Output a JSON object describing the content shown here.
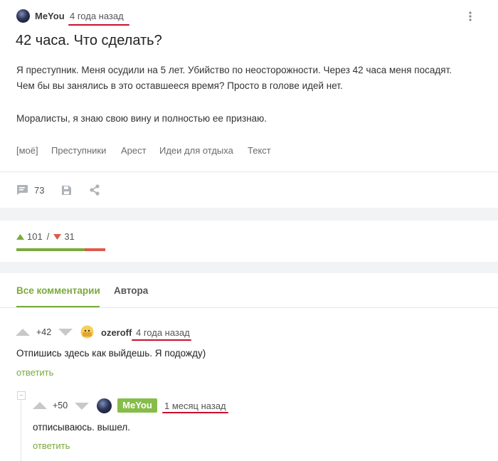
{
  "post": {
    "author": "MeYou",
    "time": "4 года назад",
    "title": "42 часа. Что сделать?",
    "body_lines": [
      "Я преступник. Меня осудили на 5 лет. Убийство по неосторожности. Через 42 часа меня посадят.",
      "Чем бы вы занялись в это оставшееся время? Просто в голове идей нет.",
      "Моралисты, я знаю свою вину и полностью ее признаю."
    ],
    "tags": [
      "[моё]",
      "Преступники",
      "Арест",
      "Идеи для отдыха",
      "Текст"
    ],
    "comments_count": "73",
    "rating_up": "101",
    "rating_separator": "/",
    "rating_down": "31",
    "rating_up_fraction": 0.765
  },
  "colors": {
    "accent_green": "#7aaa3c",
    "down_red": "#dd5a4a",
    "underline_red": "#c8102e",
    "band_gray": "#f2f3f4"
  },
  "comments_tabs": [
    "Все комментарии",
    "Автора"
  ],
  "comments": [
    {
      "score": "+42",
      "author": "ozeroff",
      "time": "4 года назад",
      "text": "Отпишись здесь как выйдешь. Я подожду)",
      "reply_label": "ответить"
    },
    {
      "score": "+50",
      "author": "MeYou",
      "time": "1 месяц назад",
      "text": "отписываюсь. вышел.",
      "reply_label": "ответить",
      "collapse_symbol": "–"
    }
  ],
  "icons": [
    "more-vertical-icon",
    "comment-icon",
    "save-icon",
    "share-icon",
    "upvote-icon",
    "downvote-icon"
  ]
}
